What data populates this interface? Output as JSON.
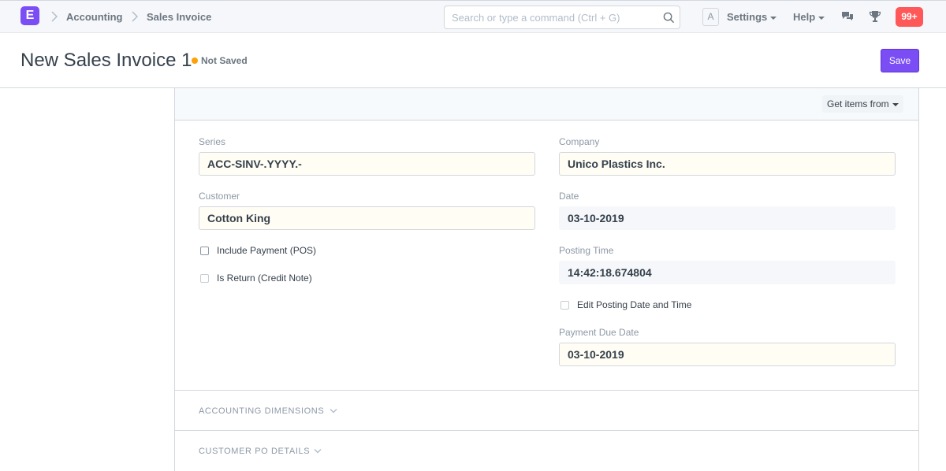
{
  "navbar": {
    "logo_letter": "E",
    "breadcrumbs": [
      "Accounting",
      "Sales Invoice"
    ],
    "search_placeholder": "Search or type a command (Ctrl + G)",
    "avatar_initial": "A",
    "settings_label": "Settings",
    "help_label": "Help",
    "notification_count": "99+",
    "icons": [
      "search-icon",
      "chat-icon",
      "trophy-icon"
    ]
  },
  "page": {
    "title": "New Sales Invoice 1",
    "status": "Not Saved",
    "status_color": "#ffa00a",
    "save_label": "Save",
    "accent_color": "#7b4df5"
  },
  "toolbar": {
    "get_items_label": "Get items from"
  },
  "form": {
    "series": {
      "label": "Series",
      "value": "ACC-SINV-.YYYY.-"
    },
    "customer": {
      "label": "Customer",
      "value": "Cotton King"
    },
    "include_payment": {
      "label": "Include Payment (POS)",
      "checked": false
    },
    "is_return": {
      "label": "Is Return (Credit Note)",
      "checked": false
    },
    "company": {
      "label": "Company",
      "value": "Unico Plastics Inc."
    },
    "date": {
      "label": "Date",
      "value": "03-10-2019"
    },
    "posting_time": {
      "label": "Posting Time",
      "value": "14:42:18.674804"
    },
    "edit_posting": {
      "label": "Edit Posting Date and Time",
      "checked": false
    },
    "payment_due_date": {
      "label": "Payment Due Date",
      "value": "03-10-2019"
    }
  },
  "sections": {
    "accounting_dimensions": "ACCOUNTING DIMENSIONS",
    "customer_po_details": "CUSTOMER PO DETAILS"
  }
}
